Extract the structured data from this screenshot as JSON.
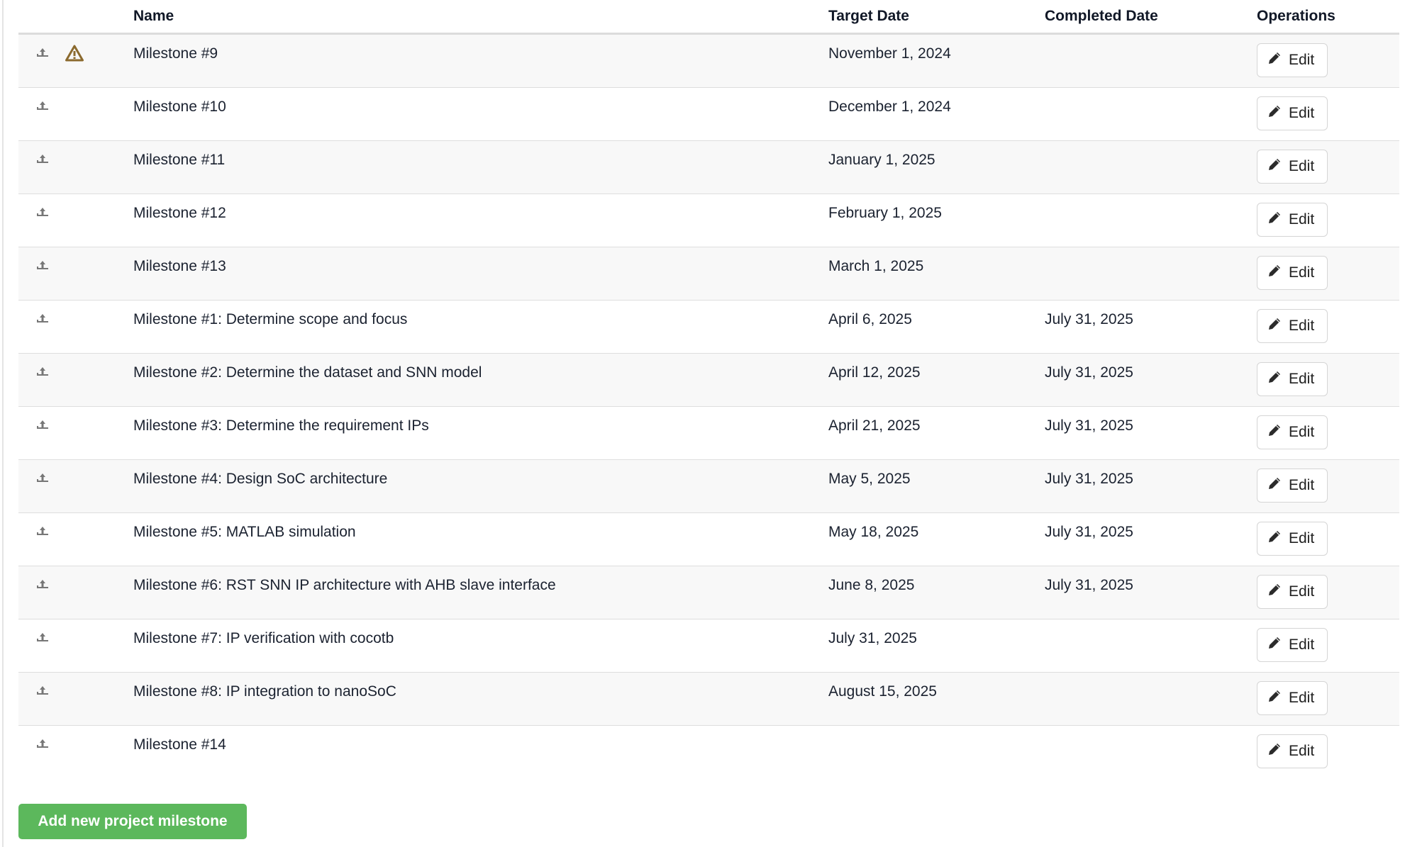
{
  "headers": {
    "name": "Name",
    "target": "Target Date",
    "completed": "Completed Date",
    "operations": "Operations"
  },
  "rows": [
    {
      "name": "Milestone #9",
      "target": "November 1, 2024",
      "completed": "",
      "warning": true
    },
    {
      "name": "Milestone #10",
      "target": "December 1, 2024",
      "completed": ""
    },
    {
      "name": "Milestone #11",
      "target": "January 1, 2025",
      "completed": ""
    },
    {
      "name": "Milestone #12",
      "target": "February 1, 2025",
      "completed": ""
    },
    {
      "name": "Milestone #13",
      "target": "March 1, 2025",
      "completed": ""
    },
    {
      "name": "Milestone #1: Determine scope and focus",
      "target": "April 6, 2025",
      "completed": "July 31, 2025"
    },
    {
      "name": "Milestone #2: Determine the dataset and SNN model",
      "target": "April 12, 2025",
      "completed": "July 31, 2025"
    },
    {
      "name": "Milestone #3: Determine the requirement IPs",
      "target": "April 21, 2025",
      "completed": "July 31, 2025"
    },
    {
      "name": "Milestone #4: Design SoC architecture",
      "target": "May 5, 2025",
      "completed": "July 31, 2025"
    },
    {
      "name": "Milestone #5: MATLAB simulation",
      "target": "May 18, 2025",
      "completed": "July 31, 2025"
    },
    {
      "name": "Milestone #6: RST SNN IP architecture with AHB slave interface",
      "target": "June 8, 2025",
      "completed": "July 31, 2025"
    },
    {
      "name": "Milestone #7: IP verification with cocotb",
      "target": "July 31, 2025",
      "completed": ""
    },
    {
      "name": "Milestone #8: IP integration to nanoSoC",
      "target": "August 15, 2025",
      "completed": ""
    },
    {
      "name": "Milestone #14",
      "target": "",
      "completed": ""
    }
  ],
  "edit_label": "Edit",
  "add_label": "Add new project milestone",
  "colors": {
    "accent": "#5cb85c",
    "warning": "#8b6a2e"
  }
}
